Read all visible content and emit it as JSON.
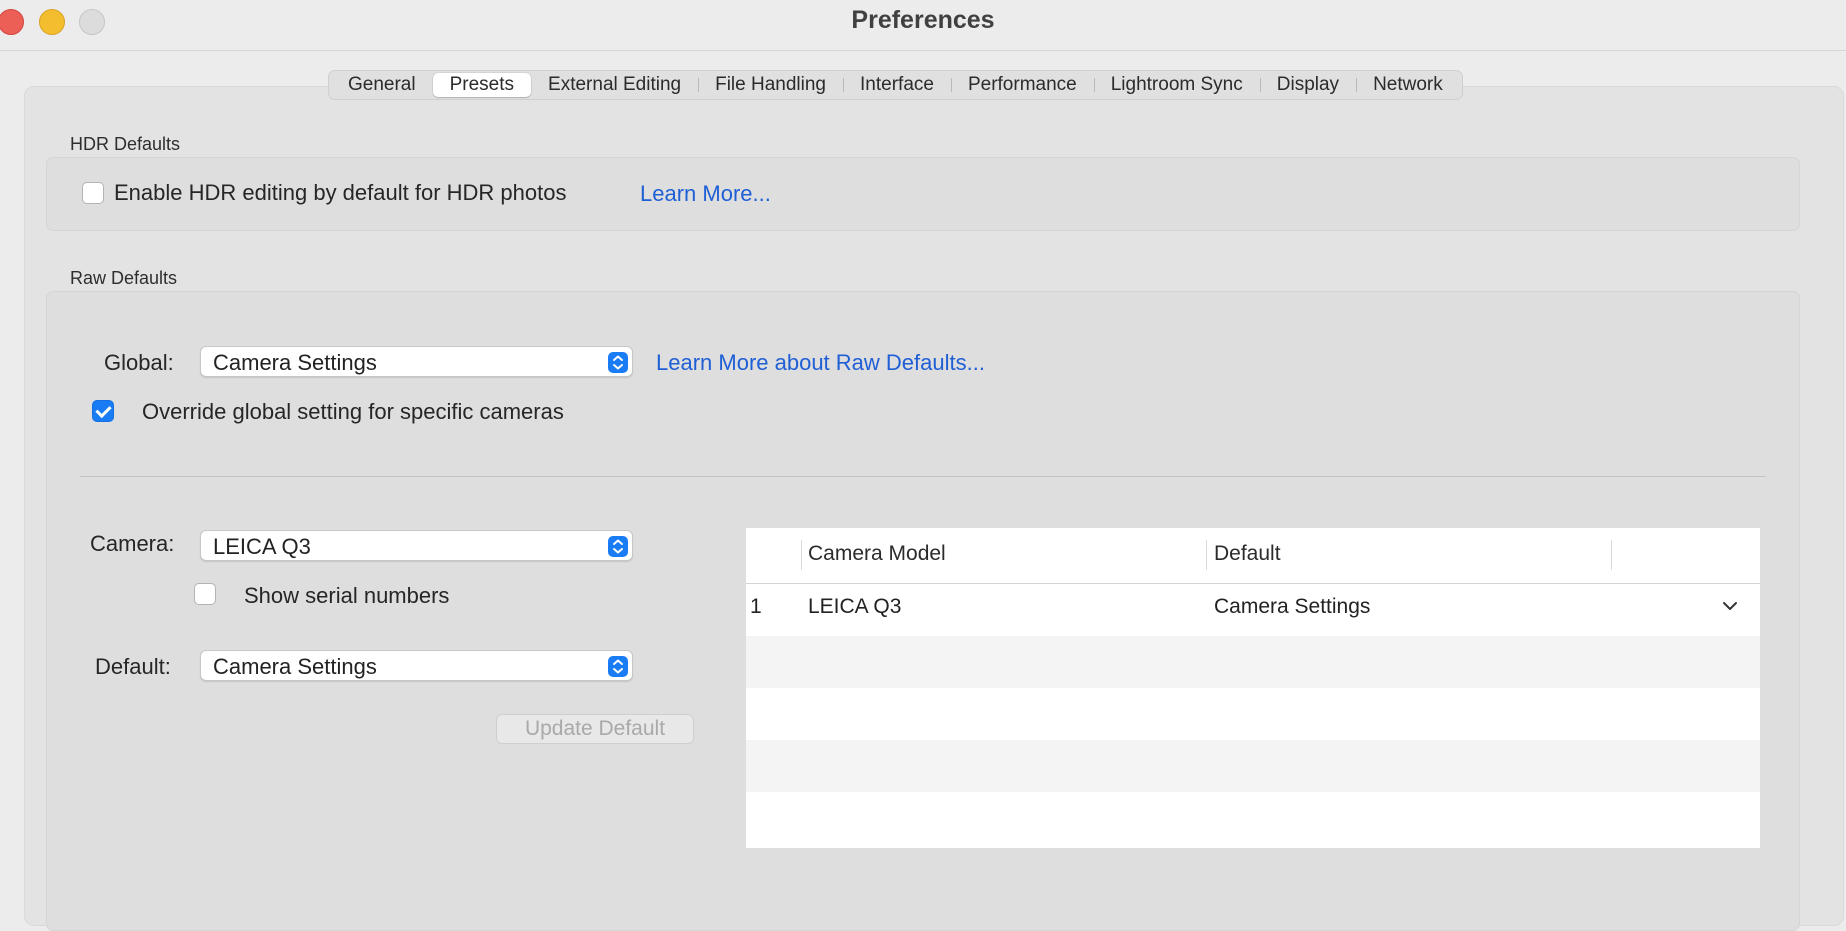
{
  "window": {
    "title": "Preferences"
  },
  "tabs": [
    {
      "label": "General",
      "active": false
    },
    {
      "label": "Presets",
      "active": true
    },
    {
      "label": "External Editing",
      "active": false
    },
    {
      "label": "File Handling",
      "active": false
    },
    {
      "label": "Interface",
      "active": false
    },
    {
      "label": "Performance",
      "active": false
    },
    {
      "label": "Lightroom Sync",
      "active": false
    },
    {
      "label": "Display",
      "active": false
    },
    {
      "label": "Network",
      "active": false
    }
  ],
  "hdr": {
    "title": "HDR Defaults",
    "enable_label": "Enable HDR editing by default for HDR photos",
    "enable_checked": false,
    "learn_more": "Learn More..."
  },
  "raw": {
    "title": "Raw Defaults",
    "global_label": "Global:",
    "global_value": "Camera Settings",
    "learn_more": "Learn More about Raw Defaults...",
    "override_label": "Override global setting for specific cameras",
    "override_checked": true,
    "camera_label": "Camera:",
    "camera_value": "LEICA Q3",
    "serial_label": "Show serial numbers",
    "serial_checked": false,
    "default_label": "Default:",
    "default_value": "Camera Settings",
    "update_button": "Update Default"
  },
  "table": {
    "columns": [
      "",
      "Camera Model",
      "Default",
      ""
    ],
    "rows": [
      {
        "index": "1",
        "model": "LEICA Q3",
        "default": "Camera Settings"
      }
    ]
  },
  "colors": {
    "accent": "#1a7cf5",
    "link": "#1f5fd6",
    "close": "#ec5f57",
    "minimize": "#f4bd2f"
  }
}
